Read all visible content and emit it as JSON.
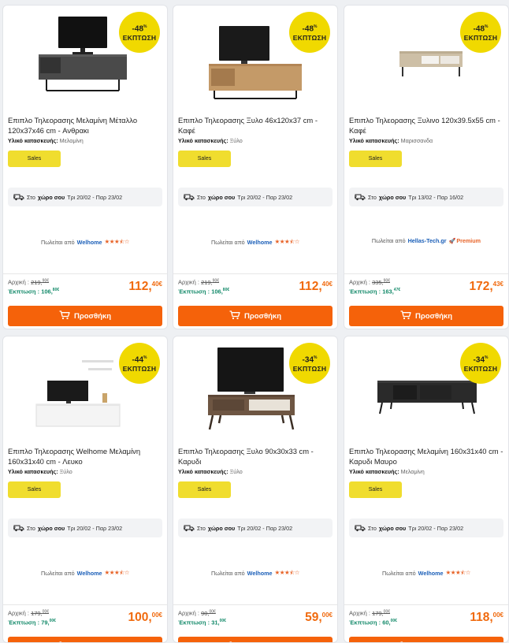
{
  "discount_word": "ΕΚΠΤΩΣΗ",
  "material_label": "Υλικό κατασκευής:",
  "sales_label": "Sales",
  "delivery_prefix": "Στο",
  "delivery_place": "χώρο σου",
  "seller_prefix": "Πωλείται από",
  "orig_label": "Αρχική :",
  "disc_label": "Έκπτωση :",
  "add_label": "Προσθήκη",
  "colors": {
    "accent": "#f5620a",
    "badge": "#f0d900",
    "sales": "#f0dd2e",
    "seller": "#1b5fb8",
    "discount": "#148a6a"
  },
  "products": [
    {
      "discount": "-48",
      "title": "Επιπλο Τηλεορασης Μελαμίνη Μέταλλο 120x37x46 cm - Ανθρακι",
      "material": "Μελαμίνη",
      "delivery_dates": "Τρι 20/02 - Παρ 23/02",
      "seller": "Welhome",
      "rating": 3.5,
      "premium": false,
      "orig_int": "219,",
      "orig_dec": "90€",
      "disc_int": "106,",
      "disc_dec": "80€",
      "price_int": "112,",
      "price_dec": "40€",
      "image": "tv-unit-dark-metal"
    },
    {
      "discount": "-48",
      "title": "Επιπλο Τηλεορασης Ξυλο 46x120x37 cm - Καφέ",
      "material": "Ξύλο",
      "delivery_dates": "Τρι 20/02 - Παρ 23/02",
      "seller": "Welhome",
      "rating": 3.5,
      "premium": false,
      "orig_int": "219,",
      "orig_dec": "90€",
      "disc_int": "106,",
      "disc_dec": "80€",
      "price_int": "112,",
      "price_dec": "40€",
      "image": "tv-unit-wood-metal"
    },
    {
      "discount": "-48",
      "title": "Επιπλο Τηλεορασης Ξυλινο 120x39.5x55 cm - Καφέ",
      "material": "Μαρισσανδα",
      "delivery_dates": "Τρι 13/02 - Παρ 16/02",
      "seller": "Hellas-Tech.gr",
      "rating": 0,
      "premium": true,
      "premium_label": "Premium",
      "orig_int": "335,",
      "orig_dec": "90€",
      "disc_int": "163,",
      "disc_dec": "47€",
      "price_int": "172,",
      "price_dec": "43€",
      "image": "tv-unit-light-wood"
    },
    {
      "discount": "-44",
      "title": "Επιπλο Τηλεορασης Welhome Μελαμίνη 160x31x40 cm - Λευκο",
      "material": "Ξύλο",
      "delivery_dates": "Τρι 20/02 - Παρ 23/02",
      "seller": "Welhome",
      "rating": 3.5,
      "premium": false,
      "orig_int": "179,",
      "orig_dec": "00€",
      "disc_int": "79,",
      "disc_dec": "00€",
      "price_int": "100,",
      "price_dec": "00€",
      "image": "tv-unit-white"
    },
    {
      "discount": "-34",
      "title": "Επιπλο Τηλεορασης Ξυλο 90x30x33 cm - Καρυδι",
      "material": "Ξύλο",
      "delivery_dates": "Τρι 20/02 - Παρ 23/02",
      "seller": "Welhome",
      "rating": 3.5,
      "premium": false,
      "orig_int": "90,",
      "orig_dec": "00€",
      "disc_int": "31,",
      "disc_dec": "00€",
      "price_int": "59,",
      "price_dec": "00€",
      "image": "tv-unit-walnut"
    },
    {
      "discount": "-34",
      "title": "Επιπλο Τηλεορασης Μελαμίνη 160x31x40 cm - Καρυδι Μαυρο",
      "material": "Μελαμίνη",
      "delivery_dates": "Τρι 20/02 - Παρ 23/02",
      "seller": "Welhome",
      "rating": 3.5,
      "premium": false,
      "orig_int": "179,",
      "orig_dec": "00€",
      "disc_int": "60,",
      "disc_dec": "00€",
      "price_int": "118,",
      "price_dec": "00€",
      "image": "tv-unit-black"
    }
  ]
}
